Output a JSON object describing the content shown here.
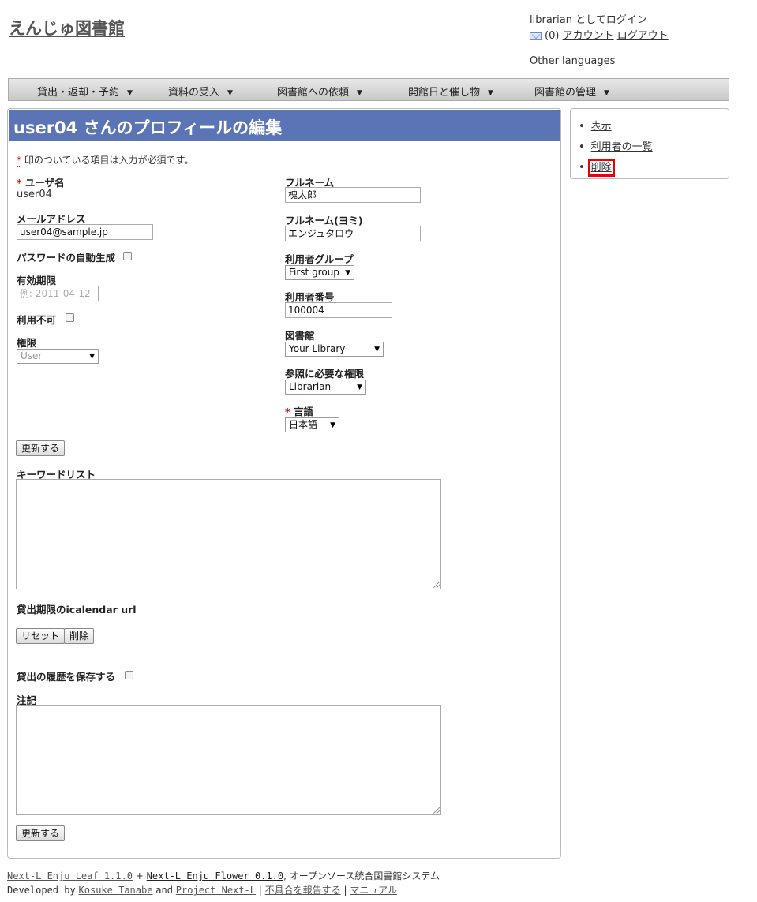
{
  "header": {
    "site_title": "えんじゅ図書館",
    "login_text": "librarian としてログイン",
    "message_count": "(0)",
    "account_link": "アカウント",
    "logout_link": "ログアウト",
    "other_languages": "Other languages"
  },
  "nav": {
    "items": [
      {
        "label": "貸出・返却・予約"
      },
      {
        "label": "資料の受入"
      },
      {
        "label": "図書館への依頼"
      },
      {
        "label": "開館日と催し物"
      },
      {
        "label": "図書館の管理"
      }
    ],
    "caret": "▼"
  },
  "page": {
    "title": "user04 さんのプロフィールの編集",
    "required_note": "印のついている項目は入力が必須です。",
    "required_mark": "*"
  },
  "form": {
    "username_label": "ユーザ名",
    "username_value": "user04",
    "email_label": "メールアドレス",
    "email_value": "user04@sample.jp",
    "auto_password_label": "パスワードの自動生成",
    "expiry_label": "有効期限",
    "expiry_placeholder": "例: 2011-04-12",
    "locked_label": "利用不可",
    "role_label": "権限",
    "role_value": "User",
    "fullname_label": "フルネーム",
    "fullname_value": "槐太郎",
    "fullname_yomi_label": "フルネーム(ヨミ)",
    "fullname_yomi_value": "エンジュタロウ",
    "user_group_label": "利用者グループ",
    "user_group_value": "First group",
    "user_number_label": "利用者番号",
    "user_number_value": "100004",
    "library_label": "図書館",
    "library_value": "Your Library",
    "required_role_label": "参照に必要な権限",
    "required_role_value": "Librarian",
    "locale_label": "言語",
    "locale_value": "日本語",
    "update_button": "更新する",
    "keyword_list_label": "キーワードリスト",
    "icalendar_label": "貸出期限のicalendar url",
    "reset_button": "リセット",
    "delete_button": "削除",
    "save_history_label": "貸出の履歴を保存する",
    "note_label": "注記",
    "update_button_bottom": "更新する"
  },
  "sidebar": {
    "items": [
      {
        "label": "表示"
      },
      {
        "label": "利用者の一覧"
      },
      {
        "label": "削除"
      }
    ],
    "bullet": "•"
  },
  "footer": {
    "enju_leaf": "Next-L Enju Leaf 1.1.0",
    "plus": "+",
    "enju_flower": "Next-L Enju Flower 0.1.0",
    "system_desc": ", オープンソース統合図書館システム",
    "developed_by": "Developed by",
    "author": "Kosuke Tanabe",
    "and": "and",
    "project": "Project Next-L",
    "sep": "|",
    "report_bug": "不具合を報告する",
    "manual": "マニュアル"
  },
  "colors": {
    "title_bar": "#5a74b6",
    "required": "#dd0000",
    "highlight": "#ee0000"
  }
}
